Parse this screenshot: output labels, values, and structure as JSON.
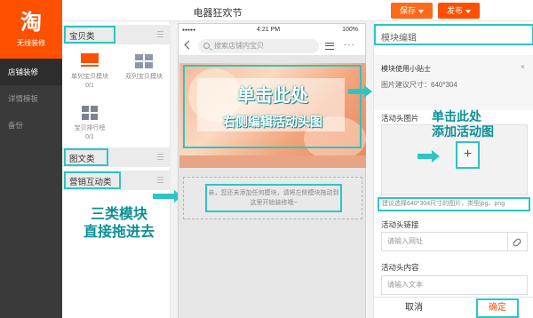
{
  "app": {
    "logo_glyph": "淘",
    "logo_text": "无线装修",
    "nav": [
      "店铺装修",
      "详情模板",
      "备份"
    ]
  },
  "header": {
    "title": "电器狂欢节",
    "save_label": "保存",
    "publish_label": "发布"
  },
  "palette": {
    "categories": [
      "宝贝类",
      "图文类",
      "营销互动类"
    ],
    "tiles": [
      {
        "label": "单列宝贝模块",
        "count": "0/1",
        "icon": "single-column-icon"
      },
      {
        "label": "双列宝贝模块",
        "count": "",
        "icon": "double-column-icon"
      },
      {
        "label": "宝贝排行榜",
        "count": "0/1",
        "icon": "ranking-grid-icon"
      }
    ]
  },
  "phone": {
    "signal": "●●●●●",
    "time": "4:21 PM",
    "battery": "100%",
    "search_placeholder": "搜索店铺内宝贝",
    "banner_line1": "单击此处",
    "banner_line2": "右侧编辑活动头图",
    "dropzone_text": "亲，您还未添加任何模块，请将左侧模块拖动到这里开始装修哦~"
  },
  "editor": {
    "title": "模块编辑",
    "tip_title": "模块使用小贴士",
    "tip_size": "图片建议尺寸：640*304",
    "tip_close": "×",
    "image_label": "活动头图片",
    "upload_plus": "+",
    "upload_hint": "建议选择640*304尺寸的图片，类型jpg、png",
    "link_label": "活动头链接",
    "link_placeholder": "请输入网址",
    "content_label": "活动头内容",
    "content_placeholder": "请输入文本",
    "cancel_label": "取消",
    "confirm_label": "确定"
  },
  "annotations": {
    "left_line1": "三类模块",
    "left_line2": "直接拖进去",
    "right_line1": "单击此处",
    "right_line2": "添加活动图"
  },
  "colors": {
    "brand": "#ff5000",
    "sidebar": "#3a3a3a",
    "highlight": "#2ec4c4",
    "annotation_text": "#0f8f96"
  }
}
